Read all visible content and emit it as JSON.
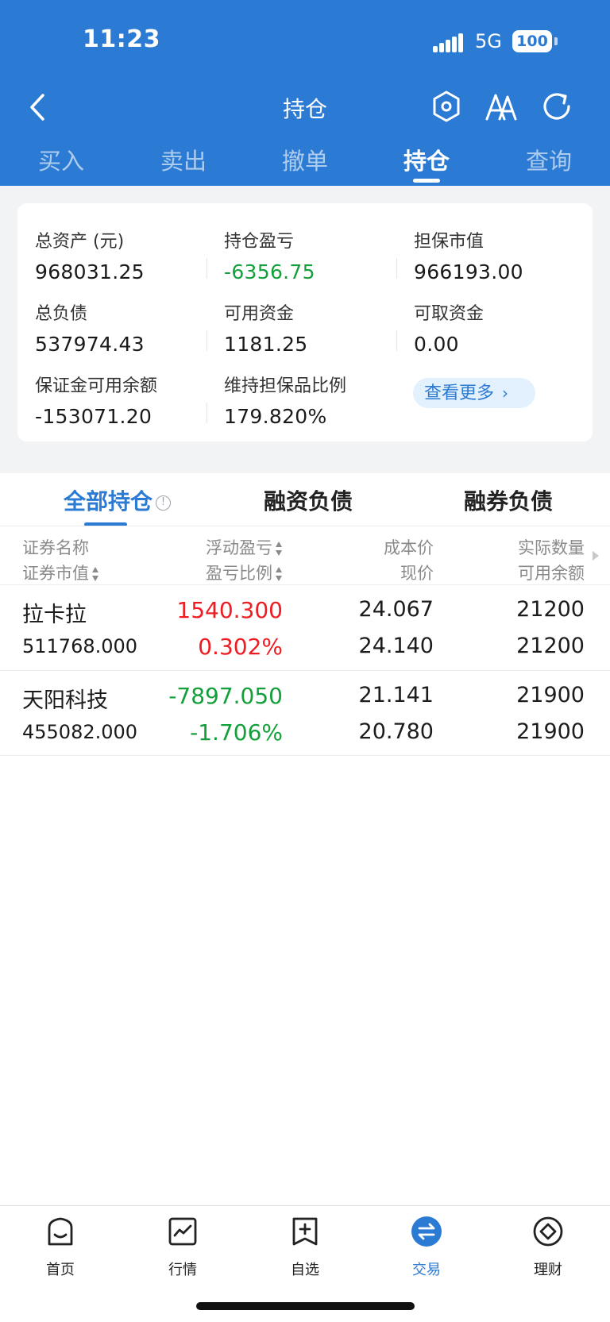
{
  "status": {
    "time": "11:23",
    "network": "5G",
    "battery": "100"
  },
  "header": {
    "title": "持仓",
    "icons": [
      "back-icon",
      "settings-hexagon-icon",
      "font-size-icon",
      "refresh-icon"
    ],
    "tabs": [
      {
        "label": "买入"
      },
      {
        "label": "卖出"
      },
      {
        "label": "撤单"
      },
      {
        "label": "持仓",
        "active": true
      },
      {
        "label": "查询"
      }
    ]
  },
  "summary": {
    "total_assets": {
      "label": "总资产 (元)",
      "value": "968031.25"
    },
    "position_pl": {
      "label": "持仓盈亏",
      "value": "-6356.75"
    },
    "collateral_value": {
      "label": "担保市值",
      "value": "966193.00"
    },
    "total_liabilities": {
      "label": "总负债",
      "value": "537974.43"
    },
    "available_funds": {
      "label": "可用资金",
      "value": "1181.25"
    },
    "withdrawable_funds": {
      "label": "可取资金",
      "value": "0.00"
    },
    "margin_available": {
      "label": "保证金可用余额",
      "value": "-153071.20"
    },
    "maintenance_ratio": {
      "label": "维持担保品比例",
      "value": "179.820%"
    },
    "more_label": "查看更多"
  },
  "positions": {
    "tabs": [
      {
        "label": "全部持仓",
        "active": true
      },
      {
        "label": "融资负债"
      },
      {
        "label": "融券负债"
      }
    ],
    "columns": {
      "name": "证券名称",
      "market_value": "证券市值",
      "float_pl": "浮动盈亏",
      "pl_ratio": "盈亏比例",
      "cost_price": "成本价",
      "current_price": "现价",
      "actual_qty": "实际数量",
      "available_qty": "可用余额"
    },
    "rows": [
      {
        "name": "拉卡拉",
        "market_value": "511768.000",
        "float_pl": "1540.300",
        "pl_ratio": "0.302%",
        "cost_price": "24.067",
        "current_price": "24.140",
        "actual_qty": "21200",
        "available_qty": "21200",
        "trend": "up"
      },
      {
        "name": "天阳科技",
        "market_value": "455082.000",
        "float_pl": "-7897.050",
        "pl_ratio": "-1.706%",
        "cost_price": "21.141",
        "current_price": "20.780",
        "actual_qty": "21900",
        "available_qty": "21900",
        "trend": "down"
      }
    ]
  },
  "bottom_nav": [
    {
      "label": "首页",
      "icon": "home-icon"
    },
    {
      "label": "行情",
      "icon": "market-chart-icon"
    },
    {
      "label": "自选",
      "icon": "watchlist-add-icon"
    },
    {
      "label": "交易",
      "icon": "trade-exchange-icon",
      "active": true
    },
    {
      "label": "理财",
      "icon": "wealth-icon"
    }
  ],
  "colors": {
    "brand_blue": "#2b7ad3",
    "up_red": "#ee1d23",
    "down_green": "#13a03a"
  }
}
